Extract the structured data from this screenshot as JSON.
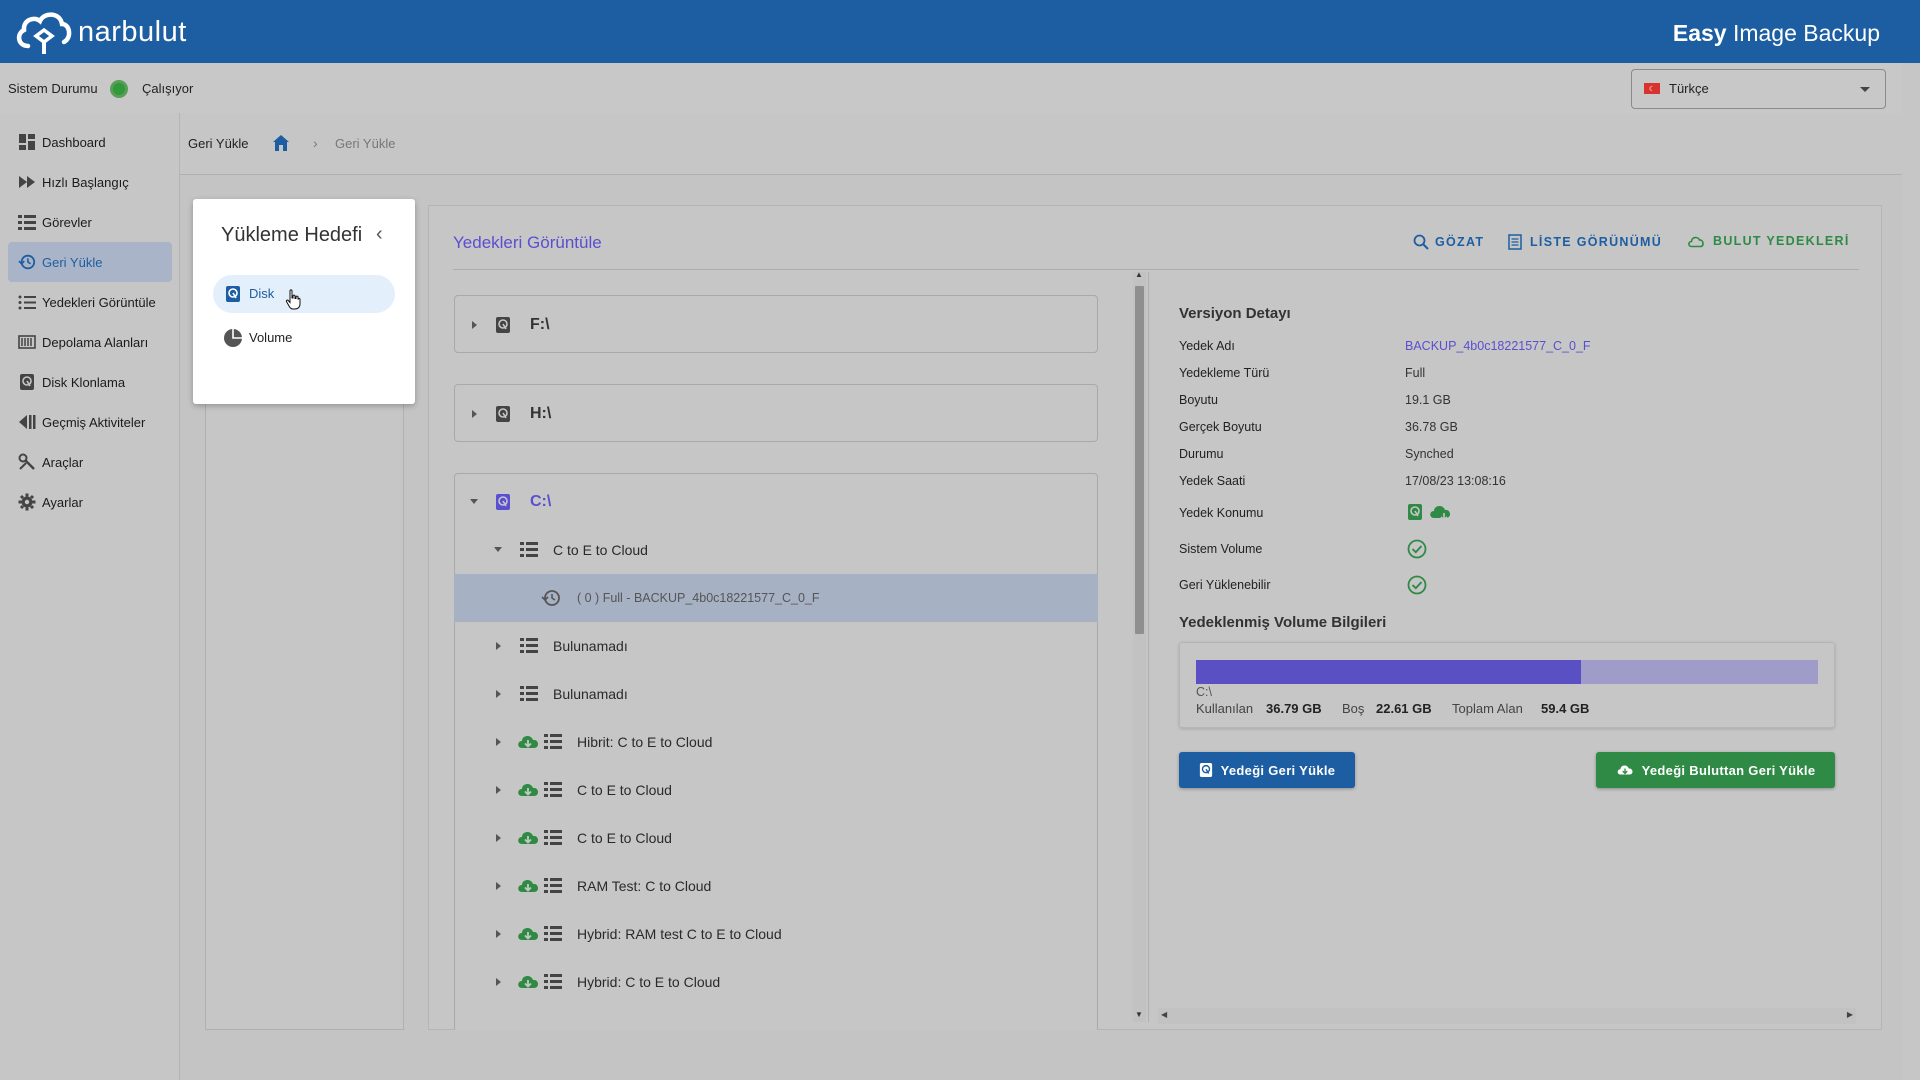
{
  "header": {
    "logo_text": "narbulut",
    "product_bold": "Easy",
    "product_rest": " Image Backup"
  },
  "status": {
    "label": "Sistem Durumu",
    "value": "Çalışıyor",
    "color": "#3a9a3a"
  },
  "language": {
    "selected": "Türkçe"
  },
  "sidebar": {
    "items": [
      {
        "label": "Dashboard",
        "icon": "dashboard-icon"
      },
      {
        "label": "Hızlı Başlangıç",
        "icon": "fast-forward-icon"
      },
      {
        "label": "Görevler",
        "icon": "list-icon"
      },
      {
        "label": "Geri Yükle",
        "icon": "restore-icon",
        "active": true
      },
      {
        "label": "Yedekleri Görüntüle",
        "icon": "list-bullets-icon"
      },
      {
        "label": "Depolama Alanları",
        "icon": "storage-icon"
      },
      {
        "label": "Disk Klonlama",
        "icon": "disk-icon"
      },
      {
        "label": "Geçmiş Aktiviteler",
        "icon": "history-icon"
      },
      {
        "label": "Araçlar",
        "icon": "tools-icon"
      },
      {
        "label": "Ayarlar",
        "icon": "gear-icon"
      }
    ]
  },
  "breadcrumb": {
    "title": "Geri Yükle",
    "current": "Geri Yükle"
  },
  "target_panel": {
    "title": "Yükleme Hedefi",
    "options": [
      {
        "label": "Disk",
        "selected": true
      },
      {
        "label": "Volume"
      }
    ]
  },
  "content": {
    "title": "Yedekleri Görüntüle",
    "actions": {
      "browse": "GÖZAT",
      "list_view": "LİSTE GÖRÜNÜMÜ",
      "cloud_backups": "BULUT YEDEKLERİ"
    }
  },
  "tree": {
    "drives": [
      "F:\\",
      "H:\\",
      "C:\\"
    ],
    "task": "C to E to Cloud",
    "version": "( 0 ) Full - BACKUP_4b0c18221577_C_0_F",
    "items": [
      {
        "label": "Bulunamadı",
        "cloud": false
      },
      {
        "label": "Bulunamadı",
        "cloud": false
      },
      {
        "label": "Hibrit: C to E to Cloud",
        "cloud": true
      },
      {
        "label": "C to E to Cloud",
        "cloud": true
      },
      {
        "label": "C to E to Cloud",
        "cloud": true
      },
      {
        "label": "RAM Test: C to Cloud",
        "cloud": true
      },
      {
        "label": "Hybrid: RAM test C to E to Cloud",
        "cloud": true
      },
      {
        "label": "Hybrid: C to E to Cloud",
        "cloud": true
      }
    ]
  },
  "detail": {
    "title": "Versiyon Detayı",
    "rows": [
      {
        "label": "Yedek Adı",
        "value": "BACKUP_4b0c18221577_C_0_F"
      },
      {
        "label": "Yedekleme Türü",
        "value": "Full"
      },
      {
        "label": "Boyutu",
        "value": "19.1 GB"
      },
      {
        "label": "Gerçek Boyutu",
        "value": "36.78 GB"
      },
      {
        "label": "Durumu",
        "value": "Synched"
      },
      {
        "label": "Yedek Saati",
        "value": "17/08/23 13:08:16"
      }
    ],
    "location_label": "Yedek Konumu",
    "system_volume_label": "Sistem Volume",
    "restorable_label": "Geri Yüklenebilir"
  },
  "volume_info": {
    "title": "Yedeklenmiş Volume Bilgileri",
    "drive": "C:\\",
    "used_label": "Kullanılan",
    "used_value": "36.79 GB",
    "free_label": "Boş",
    "free_value": "22.61 GB",
    "total_label": "Toplam Alan",
    "total_value": "59.4 GB",
    "used_fraction": 0.619,
    "used_color": "#5b4fc4",
    "free_color": "#9f9cc9"
  },
  "buttons": {
    "restore": "Yedeği Geri Yükle",
    "restore_cloud": "Yedeği Buluttan Geri Yükle"
  },
  "colors": {
    "brand": "#1d5ea3",
    "accent": "#5a4fd0",
    "green": "#2e8a44"
  }
}
